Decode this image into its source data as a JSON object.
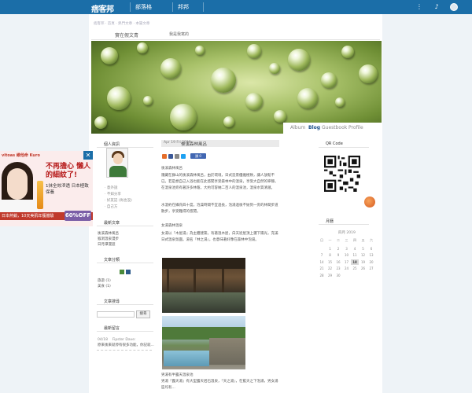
{
  "topbar": {
    "logo": "痞客邦",
    "nav_blog": "部落格",
    "nav_bang": "邦邦"
  },
  "breadcrumb": "痞客邦 ‧ 首頁 ‧ 熱門文章 ‧ 本篇文章",
  "blog": {
    "title": "實在假文青",
    "subtitle": "我是我寫的"
  },
  "tabs": {
    "album": "Album",
    "blog": "Blog",
    "guestbook": "Guestbook",
    "profile": "Profile"
  },
  "left": {
    "profile_head": "個人資訊",
    "profile_links": [
      "‧ 意外說",
      "‧ 不如分享",
      "‧ 好友記 (尚也沒)",
      "‧ 自己方"
    ],
    "recent_head": "最新文章",
    "recent_items": [
      "後溪森林風呂",
      "猴洞溫泉漫步",
      "日月潭漫遊"
    ],
    "category_head": "文章分類",
    "categories": [
      "旅遊 (1)",
      "美食 (1)"
    ],
    "search_head": "文章搜尋",
    "search_button": "搜尋",
    "comments_head": "最新留言",
    "comment_meta": "04/18 　Fipster Dave:",
    "comment_text": "原來後來就停有很多功能，你記就..."
  },
  "ad": {
    "brand": "vitoas 維他命 Kuro",
    "headline": "不再擔心 懶人的細紋了!",
    "sub": "1抹全效滲透 日本極致保養",
    "bottom": "日本熱銷，10天美肌年獲體驗",
    "percent": "60%OFF"
  },
  "post": {
    "date": "Apr 19 Fri 2019",
    "title": "後溪森林風呂",
    "like_label": "讚 0",
    "p1": "後溪森林風呂",
    "p2": "隱藏在群山的後溪森林風呂，由於環境，日式造景優雅極致，讓人放鬆不已。若是想自己入浴也能在此悠閒享受森林中的溫泉，享受大自然的寧靜。在溫泉池旁有著許多林蔭，大約可容納二百人的溫泉池，溫泉水質清澈。",
    "p3": "水溫約在攝氏四十度，泡澡時間不宜過長，泡湯過後不妨到一旁的林間步道散步，享受難得的悠閒。",
    "p4": "女湯森林溫泉",
    "p5": "女湯以『木屋湯』為主體建築，有著溫木屋，白天從屋頂上灑下陽光，充滿日式溫泉氛圍。湯名『林之湯』，也意味著好像在森林中泡湯。",
    "p6": "男湯有半露天溫泉池",
    "p7": "男湯『露天湯』有大型露天岩石溫泉，『天之湯』，在藍天之下泡湯，男女湯區均有...",
    "qr_head": "QR Code",
    "cal_head": "月曆",
    "cal_title": "四月 2019"
  },
  "calendar": {
    "weekdays": [
      "日",
      "一",
      "二",
      "三",
      "四",
      "五",
      "六"
    ],
    "days": [
      "",
      "1",
      "2",
      "3",
      "4",
      "5",
      "6",
      "7",
      "8",
      "9",
      "10",
      "11",
      "12",
      "13",
      "14",
      "15",
      "16",
      "17",
      "18",
      "19",
      "20",
      "21",
      "22",
      "23",
      "24",
      "25",
      "26",
      "27",
      "28",
      "29",
      "30"
    ],
    "today": "18"
  },
  "colors": {
    "topbar": "#1b6ea8",
    "accent": "#1b4f8a"
  }
}
